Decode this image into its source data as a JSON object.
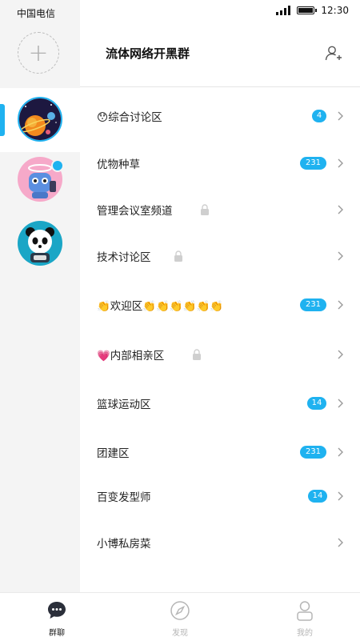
{
  "status_bar": {
    "carrier": "中国电信",
    "time": "12:30"
  },
  "header": {
    "title": "流体网络开黑群",
    "add_member_icon": "add-user-icon"
  },
  "rail": {
    "add_icon": "plus-icon",
    "avatars": [
      "group-avatar-space",
      "group-avatar-robot",
      "group-avatar-panda"
    ]
  },
  "channels": [
    {
      "label": "😯综合讨论区",
      "badge": "4",
      "locked": false
    },
    {
      "label": "优物种草",
      "badge": "231",
      "locked": false
    },
    {
      "label": "管理会议室频道",
      "badge": "",
      "locked": true
    },
    {
      "label": "技术讨论区",
      "badge": "",
      "locked": true
    },
    {
      "label": "👏欢迎区👏👏👏👏👏👏",
      "badge": "231",
      "locked": false
    },
    {
      "label": "💗内部相亲区",
      "badge": "",
      "locked": true
    },
    {
      "label": "篮球运动区",
      "badge": "14",
      "locked": false
    },
    {
      "label": "团建区",
      "badge": "231",
      "locked": false
    },
    {
      "label": "百变发型师",
      "badge": "14",
      "locked": false
    },
    {
      "label": "小博私房菜",
      "badge": "",
      "locked": false
    }
  ],
  "tabbar": [
    {
      "label": "群聊",
      "icon": "chat-bubble-icon",
      "active": true
    },
    {
      "label": "发现",
      "icon": "compass-icon",
      "active": false
    },
    {
      "label": "我的",
      "icon": "user-icon",
      "active": false
    }
  ],
  "colors": {
    "accent": "#1fb2f0",
    "rail_bg": "#f4f4f4"
  }
}
